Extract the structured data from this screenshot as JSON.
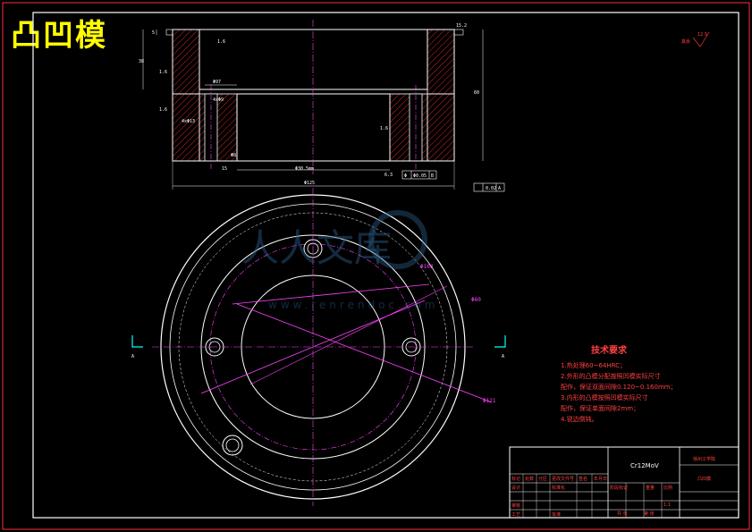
{
  "title": "凸凹模",
  "roughness": {
    "symbol": "其余",
    "value": "12.5"
  },
  "section_marks": {
    "left": "A",
    "right": "A"
  },
  "top_view_dims": {
    "d1": "5",
    "d2": "38",
    "d3": "1.6",
    "d4": "Φ97",
    "d5": "1.6",
    "d6": "1.6",
    "d7": "4xΦ13",
    "d8": "4xΦ9",
    "d9": "Φ8",
    "d10": "15",
    "d11": "Φ30.5mm",
    "d12": "Φ125",
    "d13": "6.3",
    "d14": "60",
    "d15": "15.2",
    "d16": "Φ0.05",
    "d17": "B",
    "d18": "0.02",
    "d19": "A",
    "d20": "1.6",
    "d21": "Φ"
  },
  "bottom_view_dims": {
    "r1": "Φ100",
    "r2": "Φ60",
    "r3": "Φ121"
  },
  "watermark": {
    "main": "人人文库",
    "url": "www.renrendoc.com"
  },
  "tech_requirements": {
    "title": "技术要求",
    "lines": [
      "1.热处理60~64HRC；",
      "2.外形的凸模分配按照凹模实际尺寸",
      "   配作，保证双面间隙0.120~0.160mm；",
      "3.内形的凸模按照凹模实际尺寸",
      "   配作，保证单面间隙2mm；",
      "4.锐边倒钝。"
    ]
  },
  "title_block": {
    "material": "Cr12MoV",
    "school": "徐州工学院",
    "part_name": "凸凹模",
    "cells": [
      "标记",
      "处数",
      "分区",
      "更改文件号",
      "签名",
      "年月日",
      "设计",
      "标准化",
      "审核",
      "工艺",
      "批准",
      "阶段标记",
      "重量",
      "比例",
      "共 张",
      "第 张",
      "1:1"
    ]
  }
}
